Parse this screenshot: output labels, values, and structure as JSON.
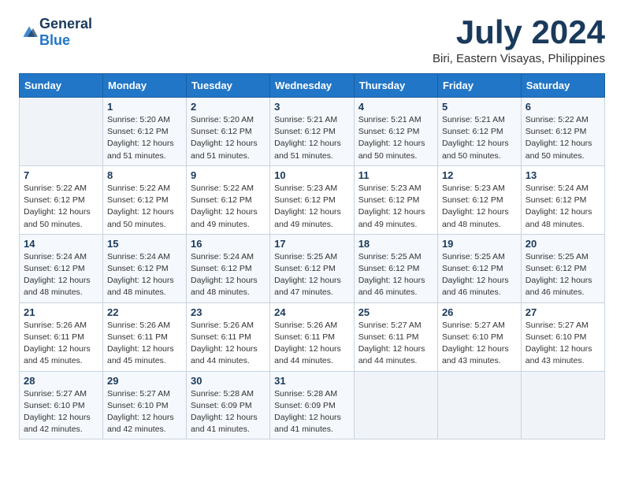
{
  "logo": {
    "general": "General",
    "blue": "Blue"
  },
  "title": "July 2024",
  "subtitle": "Biri, Eastern Visayas, Philippines",
  "header_days": [
    "Sunday",
    "Monday",
    "Tuesday",
    "Wednesday",
    "Thursday",
    "Friday",
    "Saturday"
  ],
  "weeks": [
    [
      {
        "day": "",
        "info": ""
      },
      {
        "day": "1",
        "info": "Sunrise: 5:20 AM\nSunset: 6:12 PM\nDaylight: 12 hours and 51 minutes."
      },
      {
        "day": "2",
        "info": "Sunrise: 5:20 AM\nSunset: 6:12 PM\nDaylight: 12 hours and 51 minutes."
      },
      {
        "day": "3",
        "info": "Sunrise: 5:21 AM\nSunset: 6:12 PM\nDaylight: 12 hours and 51 minutes."
      },
      {
        "day": "4",
        "info": "Sunrise: 5:21 AM\nSunset: 6:12 PM\nDaylight: 12 hours and 50 minutes."
      },
      {
        "day": "5",
        "info": "Sunrise: 5:21 AM\nSunset: 6:12 PM\nDaylight: 12 hours and 50 minutes."
      },
      {
        "day": "6",
        "info": "Sunrise: 5:22 AM\nSunset: 6:12 PM\nDaylight: 12 hours and 50 minutes."
      }
    ],
    [
      {
        "day": "7",
        "info": ""
      },
      {
        "day": "8",
        "info": "Sunrise: 5:22 AM\nSunset: 6:12 PM\nDaylight: 12 hours and 50 minutes."
      },
      {
        "day": "9",
        "info": "Sunrise: 5:22 AM\nSunset: 6:12 PM\nDaylight: 12 hours and 49 minutes."
      },
      {
        "day": "10",
        "info": "Sunrise: 5:23 AM\nSunset: 6:12 PM\nDaylight: 12 hours and 49 minutes."
      },
      {
        "day": "11",
        "info": "Sunrise: 5:23 AM\nSunset: 6:12 PM\nDaylight: 12 hours and 49 minutes."
      },
      {
        "day": "12",
        "info": "Sunrise: 5:23 AM\nSunset: 6:12 PM\nDaylight: 12 hours and 48 minutes."
      },
      {
        "day": "13",
        "info": "Sunrise: 5:24 AM\nSunset: 6:12 PM\nDaylight: 12 hours and 48 minutes."
      }
    ],
    [
      {
        "day": "14",
        "info": ""
      },
      {
        "day": "15",
        "info": "Sunrise: 5:24 AM\nSunset: 6:12 PM\nDaylight: 12 hours and 48 minutes."
      },
      {
        "day": "16",
        "info": "Sunrise: 5:24 AM\nSunset: 6:12 PM\nDaylight: 12 hours and 48 minutes."
      },
      {
        "day": "17",
        "info": "Sunrise: 5:25 AM\nSunset: 6:12 PM\nDaylight: 12 hours and 47 minutes."
      },
      {
        "day": "18",
        "info": "Sunrise: 5:25 AM\nSunset: 6:12 PM\nDaylight: 12 hours and 46 minutes."
      },
      {
        "day": "19",
        "info": "Sunrise: 5:25 AM\nSunset: 6:12 PM\nDaylight: 12 hours and 46 minutes."
      },
      {
        "day": "20",
        "info": "Sunrise: 5:25 AM\nSunset: 6:12 PM\nDaylight: 12 hours and 46 minutes."
      }
    ],
    [
      {
        "day": "21",
        "info": ""
      },
      {
        "day": "22",
        "info": "Sunrise: 5:26 AM\nSunset: 6:11 PM\nDaylight: 12 hours and 45 minutes."
      },
      {
        "day": "23",
        "info": "Sunrise: 5:26 AM\nSunset: 6:11 PM\nDaylight: 12 hours and 44 minutes."
      },
      {
        "day": "24",
        "info": "Sunrise: 5:26 AM\nSunset: 6:11 PM\nDaylight: 12 hours and 44 minutes."
      },
      {
        "day": "25",
        "info": "Sunrise: 5:27 AM\nSunset: 6:11 PM\nDaylight: 12 hours and 44 minutes."
      },
      {
        "day": "26",
        "info": "Sunrise: 5:27 AM\nSunset: 6:10 PM\nDaylight: 12 hours and 43 minutes."
      },
      {
        "day": "27",
        "info": "Sunrise: 5:27 AM\nSunset: 6:10 PM\nDaylight: 12 hours and 43 minutes."
      }
    ],
    [
      {
        "day": "28",
        "info": "Sunrise: 5:27 AM\nSunset: 6:10 PM\nDaylight: 12 hours and 42 minutes."
      },
      {
        "day": "29",
        "info": "Sunrise: 5:27 AM\nSunset: 6:10 PM\nDaylight: 12 hours and 42 minutes."
      },
      {
        "day": "30",
        "info": "Sunrise: 5:28 AM\nSunset: 6:09 PM\nDaylight: 12 hours and 41 minutes."
      },
      {
        "day": "31",
        "info": "Sunrise: 5:28 AM\nSunset: 6:09 PM\nDaylight: 12 hours and 41 minutes."
      },
      {
        "day": "",
        "info": ""
      },
      {
        "day": "",
        "info": ""
      },
      {
        "day": "",
        "info": ""
      }
    ]
  ],
  "week7_sunday_info": "Sunrise: 5:22 AM\nSunset: 6:12 PM\nDaylight: 12 hours and 50 minutes.",
  "week14_sunday_info": "Sunrise: 5:24 AM\nSunset: 6:12 PM\nDaylight: 12 hours and 48 minutes.",
  "week21_sunday_info": "Sunrise: 5:26 AM\nSunset: 6:11 PM\nDaylight: 12 hours and 45 minutes."
}
